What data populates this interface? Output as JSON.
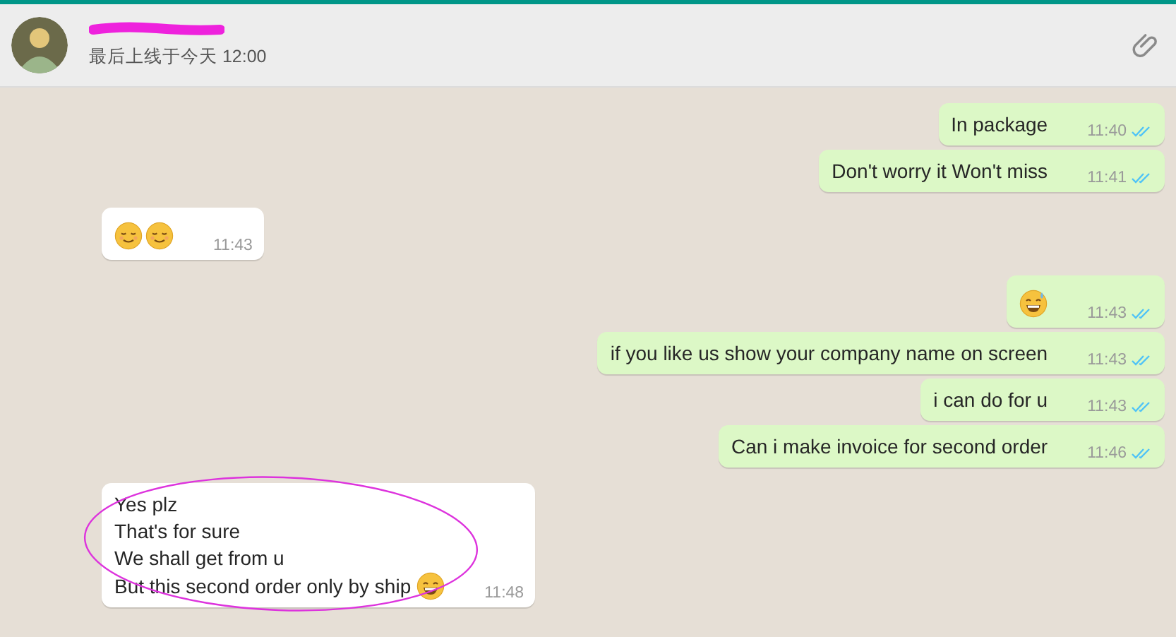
{
  "header": {
    "status": "最后上线于今天 12:00",
    "name_redacted": true
  },
  "messages": [
    {
      "kind": "outgoing",
      "lines": [
        "In package"
      ],
      "time": "11:40",
      "read": true
    },
    {
      "kind": "outgoing",
      "lines": [
        "Don't worry it Won't miss"
      ],
      "time": "11:41",
      "read": true
    },
    {
      "kind": "incoming",
      "emojis": [
        {
          "kind": "relieved"
        },
        {
          "kind": "relieved"
        }
      ],
      "time": "11:43"
    },
    {
      "kind": "outgoing",
      "emojis": [
        {
          "kind": "sweat-grin"
        }
      ],
      "time": "11:43",
      "read": true
    },
    {
      "kind": "outgoing",
      "lines": [
        "if you like us show your company name on screen"
      ],
      "time": "11:43",
      "read": true
    },
    {
      "kind": "outgoing",
      "lines": [
        "i can do for u"
      ],
      "time": "11:43",
      "read": true
    },
    {
      "kind": "outgoing",
      "lines": [
        "Can i make invoice for second order"
      ],
      "time": "11:46",
      "read": true
    },
    {
      "kind": "incoming",
      "lines": [
        "Yes plz",
        "That's for sure",
        "We shall get from u",
        "But this second order only by ship"
      ],
      "emojis": [
        {
          "kind": "grin"
        }
      ],
      "time": "11:48",
      "circled": true
    }
  ]
}
